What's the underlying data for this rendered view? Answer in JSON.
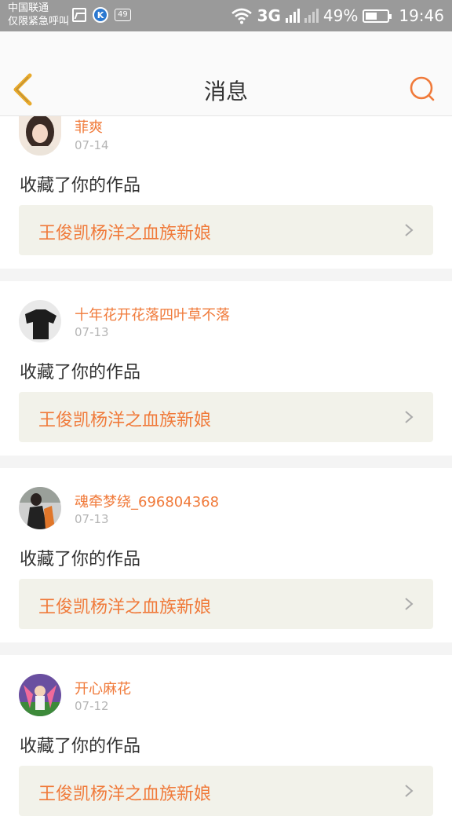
{
  "status_bar": {
    "carrier_line1": "中国联通",
    "carrier_line2": "仅限紧急呼叫",
    "badge": "49",
    "network": "3G",
    "battery": "49%",
    "time": "19:46"
  },
  "header": {
    "title": "消息",
    "accent_color": "#f07a3a"
  },
  "messages": [
    {
      "username": "菲爽",
      "date": "07-14",
      "action": "收藏了你的作品",
      "work_title": "王俊凯杨洋之血族新娘"
    },
    {
      "username": "十年花开花落四叶草不落",
      "date": "07-13",
      "action": "收藏了你的作品",
      "work_title": "王俊凯杨洋之血族新娘"
    },
    {
      "username": "魂牵梦绕_696804368",
      "date": "07-13",
      "action": "收藏了你的作品",
      "work_title": "王俊凯杨洋之血族新娘"
    },
    {
      "username": "开心麻花",
      "date": "07-12",
      "action": "收藏了你的作品",
      "work_title": "王俊凯杨洋之血族新娘"
    }
  ]
}
